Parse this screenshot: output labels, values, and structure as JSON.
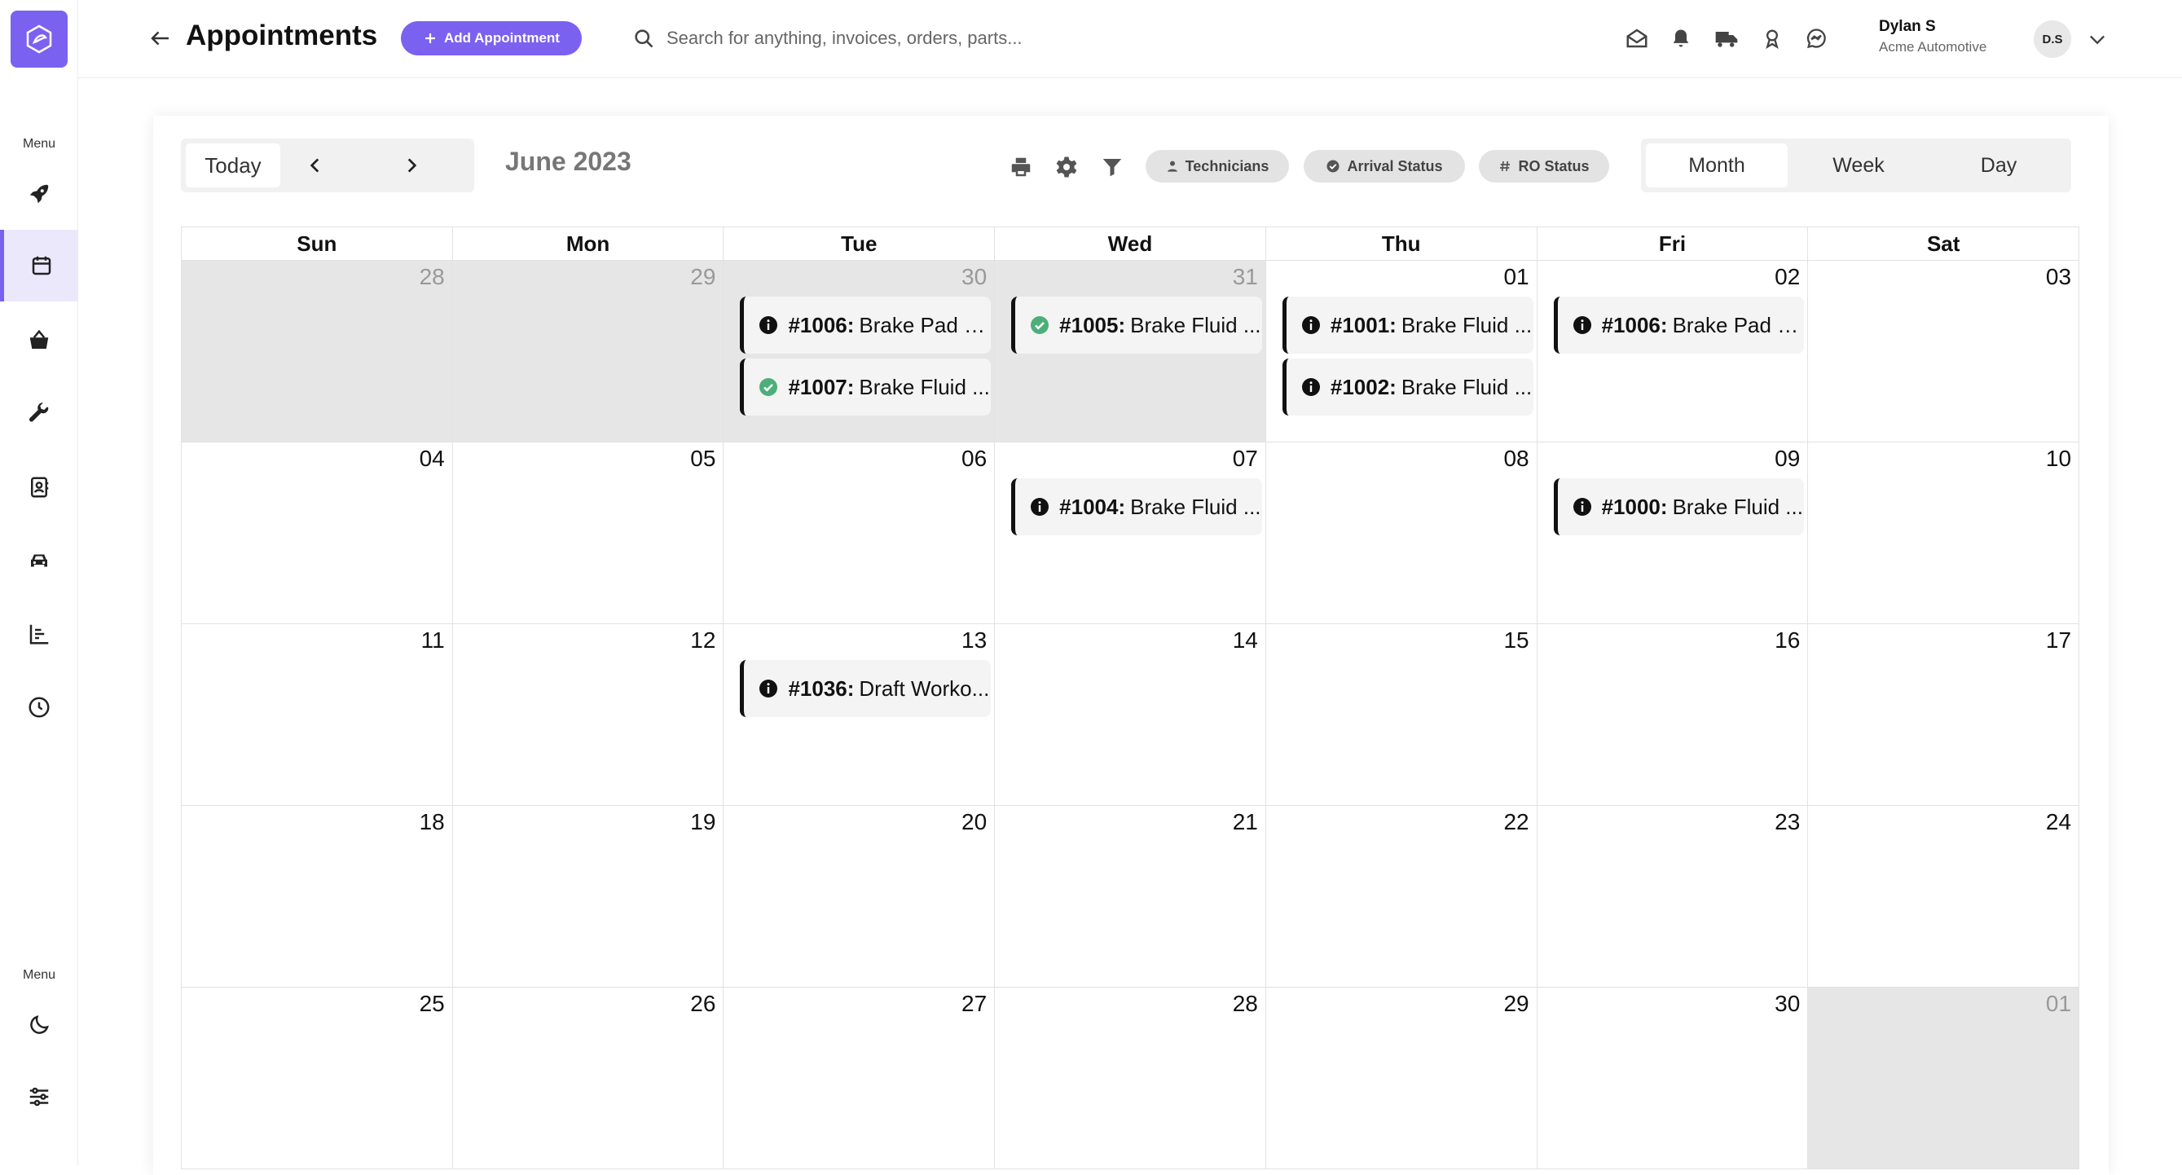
{
  "sidebar": {
    "menu_label_top": "Menu",
    "menu_label_bottom": "Menu",
    "items": [
      {
        "icon": "rocket-icon"
      },
      {
        "icon": "calendar-icon",
        "active": true
      },
      {
        "icon": "basket-icon"
      },
      {
        "icon": "wrench-icon"
      },
      {
        "icon": "contacts-icon"
      },
      {
        "icon": "car-icon"
      },
      {
        "icon": "bar-chart-icon"
      },
      {
        "icon": "clock-icon"
      },
      {
        "icon": "moon-icon"
      },
      {
        "icon": "sliders-icon"
      }
    ]
  },
  "header": {
    "title": "Appointments",
    "add_button": "Add Appointment",
    "search_placeholder": "Search for anything, invoices, orders, parts...",
    "user_name": "Dylan S",
    "user_org": "Acme Automotive",
    "avatar_initials": "D.S"
  },
  "calendar": {
    "today_label": "Today",
    "month_label": "June 2023",
    "chips": [
      "Technicians",
      "Arrival Status",
      "RO Status"
    ],
    "views": [
      "Month",
      "Week",
      "Day"
    ],
    "active_view": "Month",
    "weekdays": [
      "Sun",
      "Mon",
      "Tue",
      "Wed",
      "Thu",
      "Fri",
      "Sat"
    ],
    "weeks": [
      [
        {
          "num": "28",
          "muted": true,
          "events": []
        },
        {
          "num": "29",
          "muted": true,
          "events": []
        },
        {
          "num": "30",
          "muted": true,
          "events": [
            {
              "id": "#1006:",
              "title": "Brake Pad R...",
              "status": "info"
            },
            {
              "id": "#1007:",
              "title": "Brake Fluid ...",
              "status": "done"
            }
          ]
        },
        {
          "num": "31",
          "muted": true,
          "events": [
            {
              "id": "#1005:",
              "title": "Brake Fluid ...",
              "status": "done"
            }
          ]
        },
        {
          "num": "01",
          "muted": false,
          "events": [
            {
              "id": "#1001:",
              "title": "Brake Fluid ...",
              "status": "info"
            },
            {
              "id": "#1002:",
              "title": "Brake Fluid ...",
              "status": "info"
            }
          ]
        },
        {
          "num": "02",
          "muted": false,
          "events": [
            {
              "id": "#1006:",
              "title": "Brake Pad R...",
              "status": "info"
            }
          ]
        },
        {
          "num": "03",
          "muted": false,
          "events": []
        }
      ],
      [
        {
          "num": "04",
          "muted": false,
          "events": []
        },
        {
          "num": "05",
          "muted": false,
          "events": []
        },
        {
          "num": "06",
          "muted": false,
          "events": []
        },
        {
          "num": "07",
          "muted": false,
          "events": [
            {
              "id": "#1004:",
              "title": "Brake Fluid ...",
              "status": "info"
            }
          ]
        },
        {
          "num": "08",
          "muted": false,
          "events": []
        },
        {
          "num": "09",
          "muted": false,
          "events": [
            {
              "id": "#1000:",
              "title": "Brake Fluid ...",
              "status": "info"
            }
          ]
        },
        {
          "num": "10",
          "muted": false,
          "events": []
        }
      ],
      [
        {
          "num": "11",
          "muted": false,
          "events": []
        },
        {
          "num": "12",
          "muted": false,
          "events": []
        },
        {
          "num": "13",
          "muted": false,
          "events": [
            {
              "id": "#1036:",
              "title": "Draft Worko...",
              "status": "info"
            }
          ]
        },
        {
          "num": "14",
          "muted": false,
          "events": []
        },
        {
          "num": "15",
          "muted": false,
          "events": []
        },
        {
          "num": "16",
          "muted": false,
          "events": []
        },
        {
          "num": "17",
          "muted": false,
          "events": []
        }
      ],
      [
        {
          "num": "18",
          "muted": false,
          "events": []
        },
        {
          "num": "19",
          "muted": false,
          "events": []
        },
        {
          "num": "20",
          "muted": false,
          "events": []
        },
        {
          "num": "21",
          "muted": false,
          "events": []
        },
        {
          "num": "22",
          "muted": false,
          "events": []
        },
        {
          "num": "23",
          "muted": false,
          "events": []
        },
        {
          "num": "24",
          "muted": false,
          "events": []
        }
      ],
      [
        {
          "num": "25",
          "muted": false,
          "events": []
        },
        {
          "num": "26",
          "muted": false,
          "events": []
        },
        {
          "num": "27",
          "muted": false,
          "events": []
        },
        {
          "num": "28",
          "muted": false,
          "events": []
        },
        {
          "num": "29",
          "muted": false,
          "events": []
        },
        {
          "num": "30",
          "muted": false,
          "events": []
        },
        {
          "num": "01",
          "muted": true,
          "events": []
        }
      ]
    ]
  },
  "colors": {
    "accent": "#7b61f0",
    "done": "#4caf7a",
    "muted_cell": "#e6e6e6"
  }
}
